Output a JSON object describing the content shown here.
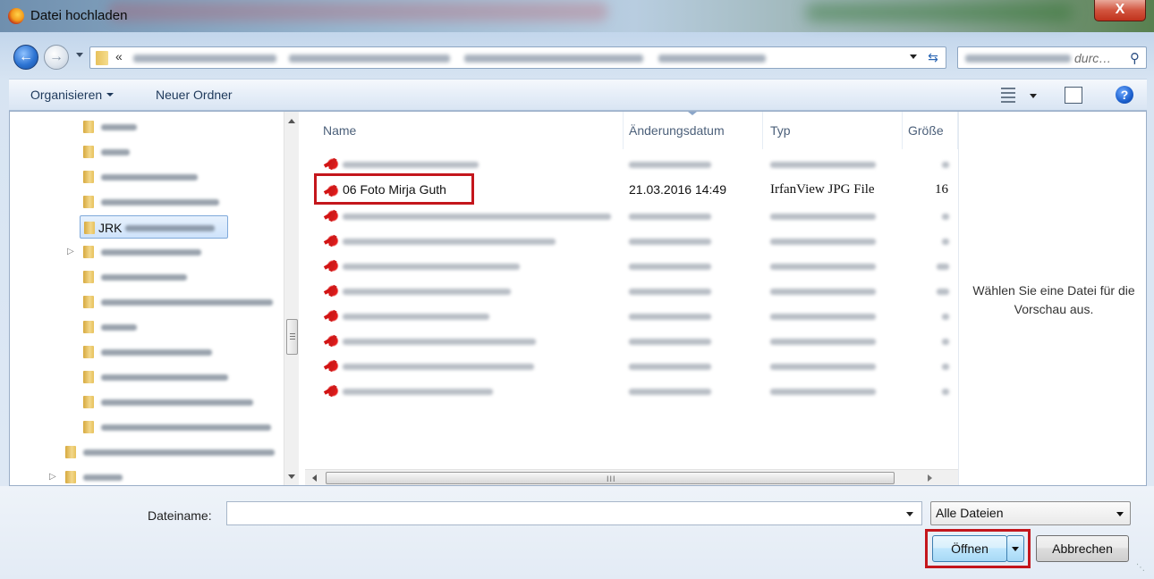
{
  "window": {
    "title": "Datei hochladen",
    "close_label": "X"
  },
  "address": {
    "chevron": "«"
  },
  "search": {
    "placeholder": "durc…"
  },
  "toolbar": {
    "organize_label": "Organisieren",
    "new_folder_label": "Neuer Ordner",
    "help_label": "?"
  },
  "nav": {
    "selected_label": "JRK"
  },
  "columns": {
    "name": "Name",
    "date": "Änderungsdatum",
    "type": "Typ",
    "size": "Größe"
  },
  "files": {
    "highlighted": {
      "name": "06 Foto Mirja Guth",
      "date": "21.03.2016 14:49",
      "type": "IrfanView JPG File",
      "size": "16"
    }
  },
  "preview": {
    "message": "Wählen Sie eine Datei für die Vorschau aus."
  },
  "hscroll": {
    "grip": "III"
  },
  "footer": {
    "filename_label": "Dateiname:",
    "filename_value": "",
    "filetype_value": "Alle Dateien",
    "open_label": "Öffnen",
    "cancel_label": "Abbrechen"
  },
  "icons": {
    "app": "firefox-icon",
    "folder": "folder-icon",
    "file": "irfanview-jpg-icon",
    "search": "search-icon",
    "help": "help-icon",
    "refresh": "refresh-icon"
  },
  "colors": {
    "highlight": "#c4161c",
    "accent": "#3c7fb1"
  }
}
